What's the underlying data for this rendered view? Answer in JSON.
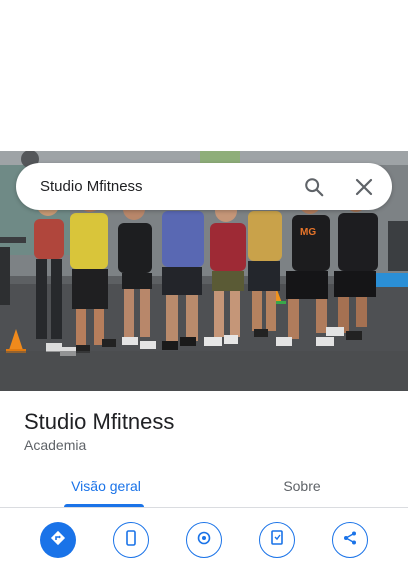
{
  "search": {
    "query": "Studio Mfitness",
    "search_icon": "search-icon",
    "clear_icon": "close-icon"
  },
  "photo": {
    "shirt_text": "MG"
  },
  "place": {
    "name": "Studio Mfitness",
    "category": "Academia"
  },
  "tabs": [
    {
      "label": "Visão geral",
      "selected": true
    },
    {
      "label": "Sobre",
      "selected": false
    }
  ],
  "actions": [
    {
      "icon": "directions-icon",
      "style": "primary"
    },
    {
      "icon": "phone-icon",
      "style": "outline"
    },
    {
      "icon": "location-icon",
      "style": "outline"
    },
    {
      "icon": "save-icon",
      "style": "outline"
    },
    {
      "icon": "share-icon",
      "style": "outline"
    }
  ],
  "colors": {
    "accent": "#1a73e8",
    "text_primary": "#202124",
    "text_secondary": "#5f6368"
  }
}
